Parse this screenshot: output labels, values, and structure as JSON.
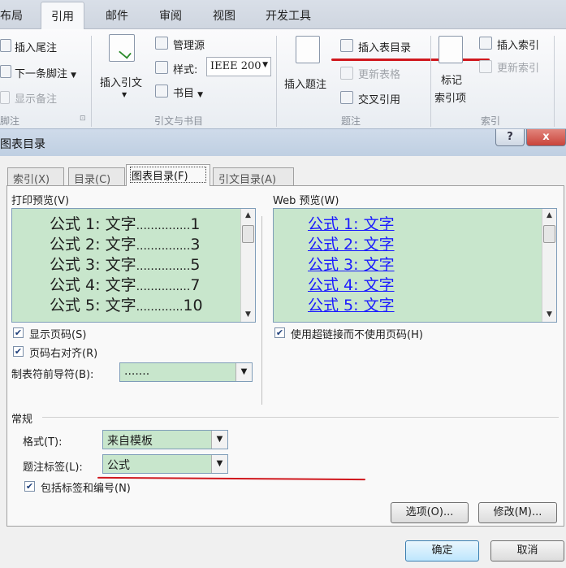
{
  "ribbon": {
    "tabs": [
      "布局",
      "引用",
      "邮件",
      "审阅",
      "视图",
      "开发工具"
    ],
    "active_tab": "引用",
    "footnotes": {
      "insert_endnote": "插入尾注",
      "next_footnote": "下一条脚注",
      "show_notes": "显示备注",
      "group_label": "脚注"
    },
    "citations": {
      "insert_citation": "插入引文",
      "manage_sources": "管理源",
      "style_label": "样式:",
      "style_value": "IEEE 200",
      "bibliography": "书目",
      "group_label": "引文与书目"
    },
    "captions": {
      "insert_caption": "插入题注",
      "insert_tof": "插入表目录",
      "update_table": "更新表格",
      "cross_reference": "交叉引用",
      "group_label": "题注"
    },
    "index": {
      "mark_entry_line1": "标记",
      "mark_entry_line2": "索引项",
      "insert_index": "插入索引",
      "update_index": "更新索引",
      "group_label": "索引"
    }
  },
  "dialog": {
    "title": "图表目录",
    "help": "?",
    "close": "x",
    "tabs": [
      "索引(X)",
      "目录(C)",
      "图表目录(F)",
      "引文目录(A)"
    ],
    "selected_tab": "图表目录(F)",
    "print_preview": {
      "label": "打印预览(V)",
      "lines": [
        {
          "text": "公式 1: 文字",
          "leader": "...............",
          "page": "1"
        },
        {
          "text": "公式 2: 文字",
          "leader": "...............",
          "page": "3"
        },
        {
          "text": "公式 3: 文字",
          "leader": "...............",
          "page": "5"
        },
        {
          "text": "公式 4: 文字",
          "leader": "...............",
          "page": "7"
        },
        {
          "text": "公式 5: 文字",
          "leader": ".............",
          "page": "10"
        }
      ]
    },
    "web_preview": {
      "label": "Web 预览(W)",
      "lines": [
        "公式 1: 文字",
        "公式 2: 文字",
        "公式 3: 文字",
        "公式 4: 文字",
        "公式 5: 文字"
      ]
    },
    "options": {
      "show_page_numbers": {
        "label": "显示页码(S)",
        "checked": true
      },
      "right_align": {
        "label": "页码右对齐(R)",
        "checked": true
      },
      "tab_leader_label": "制表符前导符(B):",
      "tab_leader_value": ".......",
      "use_hyperlinks": {
        "label": "使用超链接而不使用页码(H)",
        "checked": true
      }
    },
    "general": {
      "section_label": "常规",
      "format_label": "格式(T):",
      "format_value": "来自模板",
      "caption_label": "题注标签(L):",
      "caption_value": "公式",
      "include_label": {
        "label": "包括标签和编号(N)",
        "checked": true
      }
    },
    "buttons": {
      "options": "选项(O)...",
      "modify": "修改(M)...",
      "ok": "确定",
      "cancel": "取消"
    }
  },
  "colors": {
    "preview_bg": "#c8e6cc",
    "annotation_red": "#d0181e",
    "hyperlink": "#1a1aff",
    "close_button": "#c9443b"
  }
}
